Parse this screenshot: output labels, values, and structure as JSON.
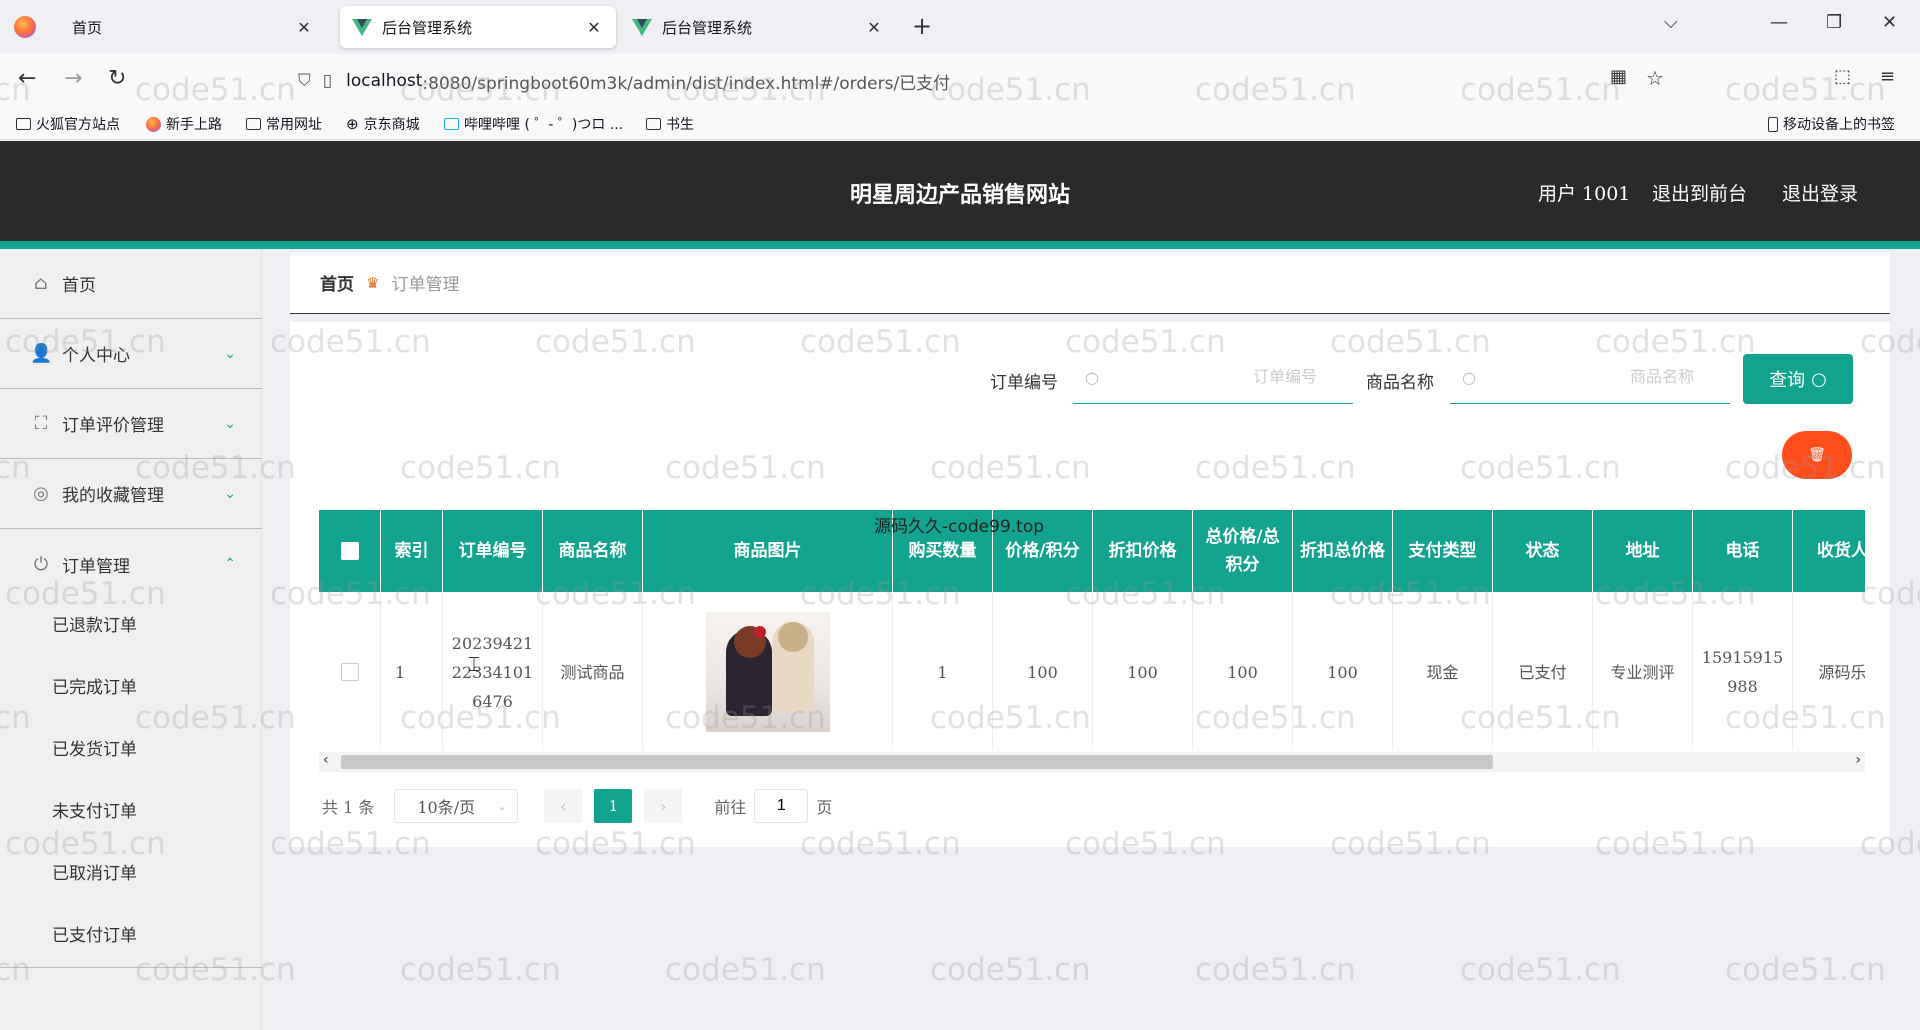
{
  "browser": {
    "tabs": [
      {
        "title": "首页",
        "close": "✕"
      },
      {
        "title": "后台管理系统",
        "close": "✕"
      },
      {
        "title": "后台管理系统",
        "close": "✕"
      }
    ],
    "new_tab": "+",
    "url_host": "localhost",
    "url_rest": ":8080/springboot60m3k/admin/dist/index.html#/orders/已支付",
    "bookmarks": [
      "火狐官方站点",
      "新手上路",
      "常用网址",
      "京东商城",
      "哔哩哔哩 ( ゜- ゜)つロ ...",
      "书生"
    ],
    "mobile_bookmarks": "移动设备上的书签"
  },
  "header": {
    "title": "明星周边产品销售网站",
    "user": "用户 1001",
    "to_front": "退出到前台",
    "logout": "退出登录"
  },
  "sidebar": {
    "items": [
      {
        "label": "首页",
        "icon": "home-icon"
      },
      {
        "label": "个人中心",
        "icon": "user-icon"
      },
      {
        "label": "订单评价管理",
        "icon": "frame-icon"
      },
      {
        "label": "我的收藏管理",
        "icon": "compass-icon"
      },
      {
        "label": "订单管理",
        "icon": "power-icon"
      }
    ],
    "sub_items": [
      "已退款订单",
      "已完成订单",
      "已发货订单",
      "未支付订单",
      "已取消订单",
      "已支付订单"
    ]
  },
  "breadcrumb": {
    "home": "首页",
    "current": "订单管理"
  },
  "search": {
    "order_label": "订单编号",
    "order_placeholder": "订单编号",
    "product_label": "商品名称",
    "product_placeholder": "商品名称",
    "query_label": "查询"
  },
  "table": {
    "headers": [
      "索引",
      "订单编号",
      "商品名称",
      "商品图片",
      "购买数量",
      "价格/积分",
      "折扣价格",
      "总价格/总积分",
      "折扣总价格",
      "支付类型",
      "状态",
      "地址",
      "电话",
      "收货人"
    ],
    "rows": [
      {
        "index": "1",
        "order_no_1": "20239421",
        "order_no_2": "22334101",
        "order_no_3": "6476",
        "product": "测试商品",
        "qty": "1",
        "price": "100",
        "discount_price": "100",
        "total": "100",
        "discount_total": "100",
        "pay_type": "现金",
        "status": "已支付",
        "address": "专业测评",
        "phone_1": "15915915",
        "phone_2": "988",
        "receiver": "源码乐"
      }
    ]
  },
  "pagination": {
    "total": "共 1 条",
    "page_size": "10条/页",
    "current": "1",
    "goto_prefix": "前往",
    "goto_value": "1",
    "goto_suffix": "页"
  },
  "watermark": {
    "text": "code51.cn",
    "source_text": "源码久久-code99.top"
  },
  "colors": {
    "accent": "#12a38f",
    "header_bg": "#2a2a2a",
    "danger": "#ff4d1c"
  }
}
